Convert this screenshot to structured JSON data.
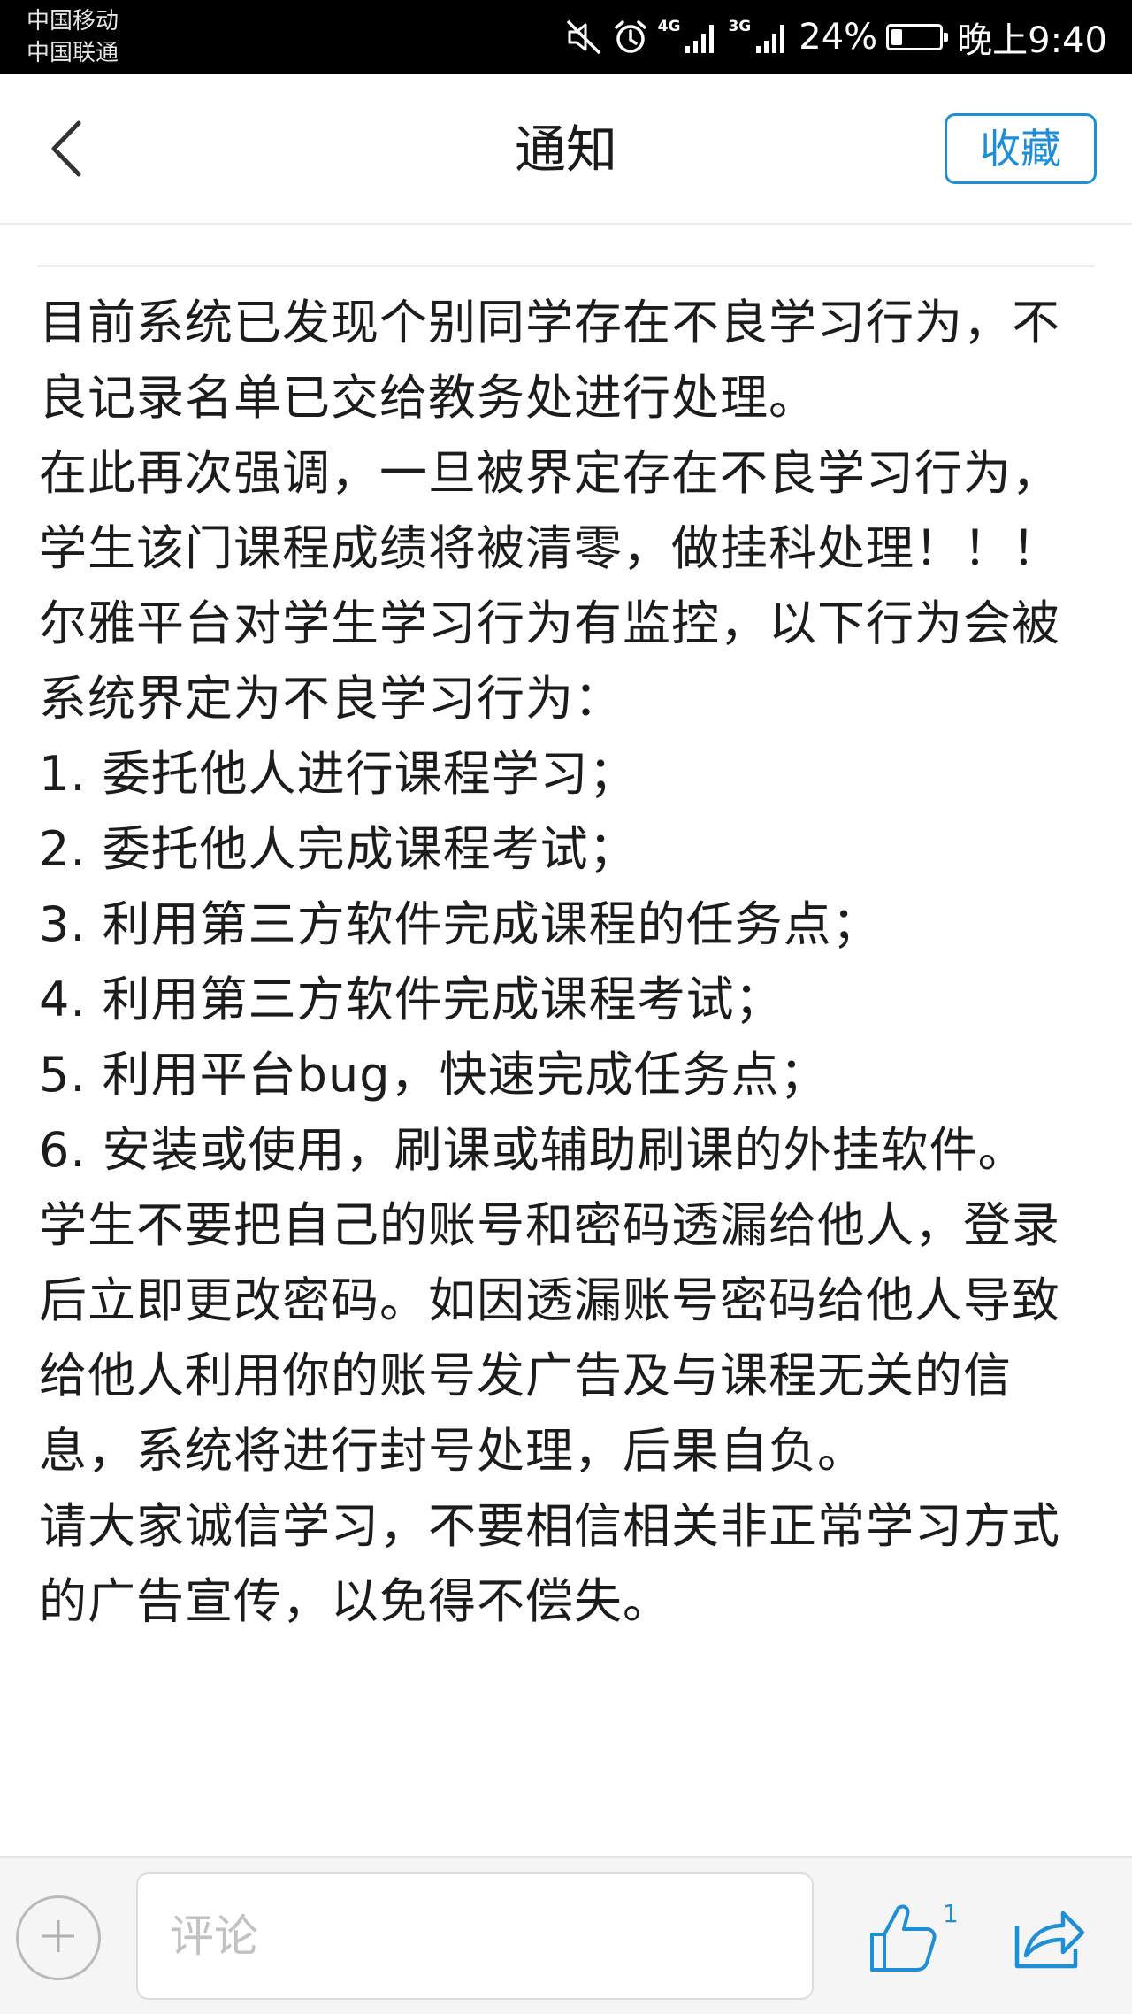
{
  "status_bar": {
    "carrier_1": "中国移动",
    "carrier_2": "中国联通",
    "net_1": "4G",
    "net_2": "3G",
    "battery_percent": "24%",
    "battery_level": 0.24,
    "time": "晚上9:40",
    "icons": [
      "mute-icon",
      "alarm-icon",
      "signal-icon",
      "battery-icon"
    ]
  },
  "nav": {
    "title": "通知",
    "back_icon": "chevron-left-icon",
    "favorite_label": "收藏"
  },
  "notice": {
    "paragraphs": [
      "目前系统已发现个别同学存在不良学习行为，不良记录名单已交给教务处进行处理。",
      "在此再次强调，一旦被界定存在不良学习行为，学生该门课程成绩将被清零，做挂科处理！！！",
      "尔雅平台对学生学习行为有监控，以下行为会被系统界定为不良学习行为：",
      "1. 委托他人进行课程学习；",
      "2. 委托他人完成课程考试；",
      "3. 利用第三方软件完成课程的任务点；",
      "4. 利用第三方软件完成课程考试；",
      "5. 利用平台bug，快速完成任务点；",
      "6. 安装或使用，刷课或辅助刷课的外挂软件。",
      "学生不要把自己的账号和密码透漏给他人，登录后立即更改密码。如因透漏账号密码给他人导致给他人利用你的账号发广告及与课程无关的信息，系统将进行封号处理，后果自负。",
      "请大家诚信学习，不要相信相关非正常学习方式的广告宣传，以免得不偿失。"
    ]
  },
  "bottom_bar": {
    "add_icon": "plus-circle-icon",
    "comment_placeholder": "评论",
    "like_icon": "thumbs-up-icon",
    "like_count": "1",
    "share_icon": "share-icon"
  },
  "colors": {
    "accent": "#1e8ed6",
    "status_bar_bg": "#000000",
    "bottom_bar_bg": "#f5f5f5"
  }
}
